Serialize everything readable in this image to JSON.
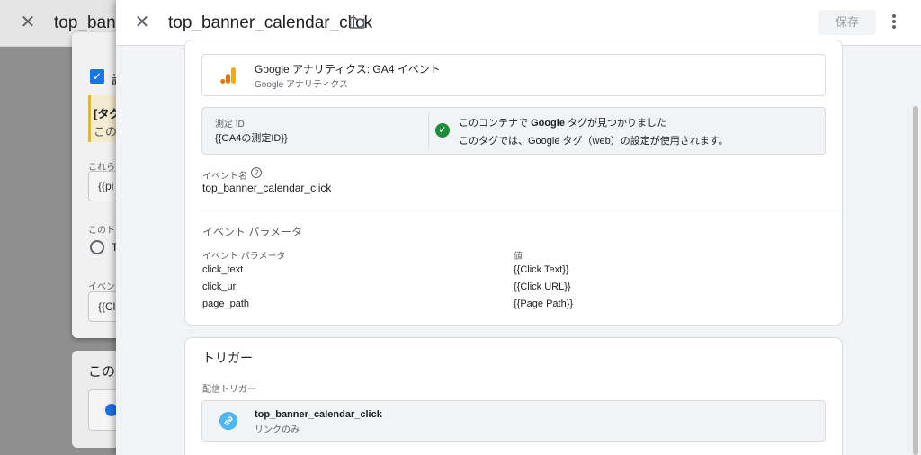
{
  "background_window": {
    "title": "top_bann",
    "checkbox_label": "設",
    "note_bold": "[タグ",
    "note_text": "この",
    "label_1": "これら",
    "input_1": "{{pi",
    "label_2": "このト",
    "radio_label": "T",
    "label_3": "イベン",
    "input_2": "{{Cl",
    "section_title": "この"
  },
  "header": {
    "title": "top_banner_calendar_click",
    "save_label": "保存"
  },
  "tag_type": {
    "title": "Google アナリティクス: GA4 イベント",
    "subtitle": "Google アナリティクス"
  },
  "measurement": {
    "label": "測定 ID",
    "value": "{{GA4の測定ID}}",
    "found_prefix": "このコンテナで ",
    "found_bold": "Google",
    "found_suffix": " タグが見つかりました",
    "settings_text": "このタグでは、Google タグ（web）の設定が使用されます。"
  },
  "event_name": {
    "label": "イベント名",
    "value": "top_banner_calendar_click"
  },
  "event_parameters": {
    "section_title": "イベント パラメータ",
    "header_name": "イベント パラメータ",
    "header_value": "値",
    "rows": [
      {
        "name": "click_text",
        "value": "{{Click Text}}"
      },
      {
        "name": "click_url",
        "value": "{{Click URL}}"
      },
      {
        "name": "page_path",
        "value": "{{Page Path}}"
      }
    ]
  },
  "trigger": {
    "section_title": "トリガー",
    "label": "配信トリガー",
    "name": "top_banner_calendar_click",
    "subtitle": "リンクのみ"
  },
  "colors": {
    "accent": "#1a73e8",
    "ga_orange": "#f9ab00",
    "ga_dark_orange": "#e37400",
    "success_green": "#1e8e3e",
    "link_blue": "#4db6f5"
  }
}
